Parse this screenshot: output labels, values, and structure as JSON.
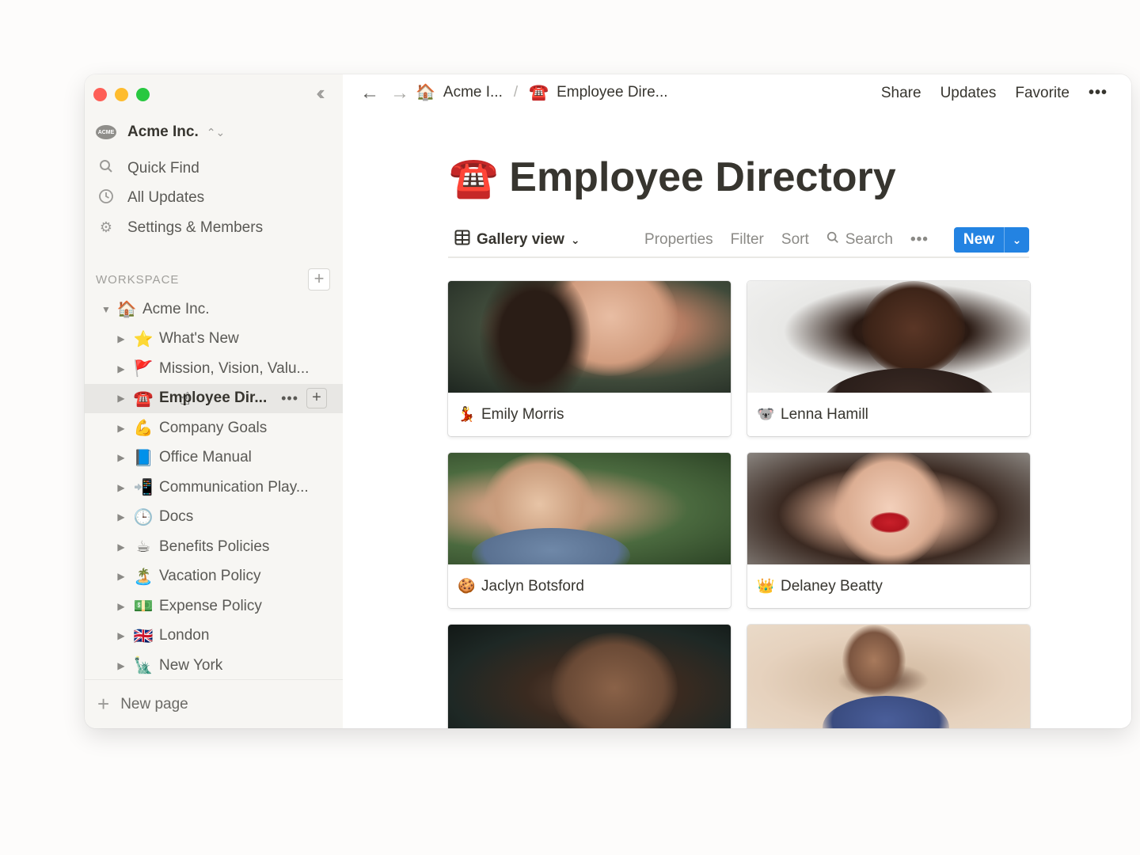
{
  "window": {
    "sidebar": {
      "workspace_name": "Acme Inc.",
      "workspace_logo_text": "ACME",
      "nav_items": [
        {
          "label": "Quick Find",
          "icon": "search-icon"
        },
        {
          "label": "All Updates",
          "icon": "clock-icon"
        },
        {
          "label": "Settings & Members",
          "icon": "gear-icon"
        }
      ],
      "workspace_section_label": "WORKSPACE",
      "tree": [
        {
          "label": "Acme Inc.",
          "emoji": "🏠",
          "level": 0
        },
        {
          "label": "What's New",
          "emoji": "⭐",
          "level": 1
        },
        {
          "label": "Mission, Vision, Valu...",
          "emoji": "🚩",
          "level": 1
        },
        {
          "label": "Employee Dir...",
          "emoji": "☎️",
          "level": 1,
          "active": true
        },
        {
          "label": "Company Goals",
          "emoji": "💪",
          "level": 1
        },
        {
          "label": "Office Manual",
          "emoji": "📘",
          "level": 1
        },
        {
          "label": "Communication Play...",
          "emoji": "📲",
          "level": 1
        },
        {
          "label": "Docs",
          "emoji": "🕒",
          "level": 1
        },
        {
          "label": "Benefits Policies",
          "emoji": "☕",
          "level": 1
        },
        {
          "label": "Vacation Policy",
          "emoji": "🏝️",
          "level": 1
        },
        {
          "label": "Expense Policy",
          "emoji": "💵",
          "level": 1
        },
        {
          "label": "London",
          "emoji": "🇬🇧",
          "level": 1
        },
        {
          "label": "New York",
          "emoji": "🗽",
          "level": 1
        }
      ],
      "new_page_label": "New page"
    },
    "topbar": {
      "breadcrumbs": [
        {
          "label": "Acme I...",
          "emoji": "🏠"
        },
        {
          "label": "Employee Dire...",
          "emoji": "☎️"
        }
      ],
      "separator": "/",
      "actions": [
        "Share",
        "Updates",
        "Favorite"
      ],
      "more": "•••"
    },
    "page": {
      "title": "Employee Directory",
      "title_emoji": "☎️",
      "toolbar": {
        "view_label": "Gallery view",
        "properties": "Properties",
        "filter": "Filter",
        "sort": "Sort",
        "search": "Search",
        "more": "•••",
        "new_label": "New"
      },
      "cards": [
        {
          "name": "Emily Morris",
          "emoji": "💃"
        },
        {
          "name": "Lenna Hamill",
          "emoji": "🐨"
        },
        {
          "name": "Jaclyn Botsford",
          "emoji": "🍪"
        },
        {
          "name": "Delaney Beatty",
          "emoji": "👑"
        },
        {
          "name": "",
          "emoji": ""
        },
        {
          "name": "",
          "emoji": ""
        }
      ]
    }
  }
}
